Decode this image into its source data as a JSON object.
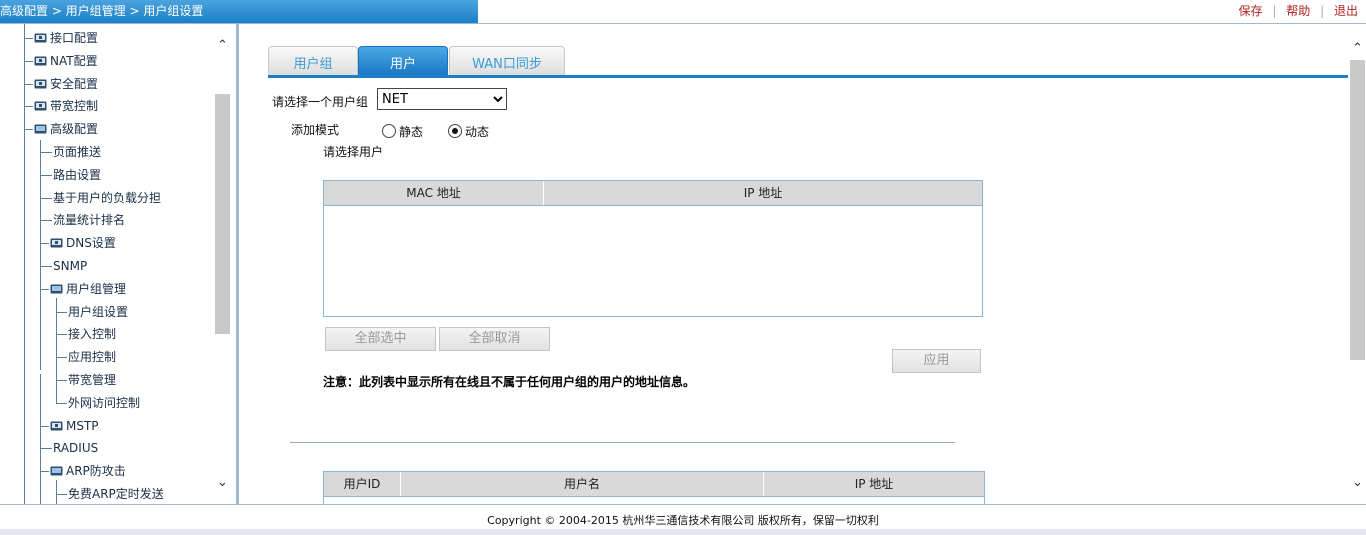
{
  "header": {
    "breadcrumb": "高级配置 > 用户组管理 > 用户组设置",
    "menu": {
      "save": "保存",
      "help": "帮助",
      "logout": "退出",
      "sep": "|"
    }
  },
  "sidebar": {
    "items": [
      {
        "label": "接口配置",
        "icon": "folder-closed-icon"
      },
      {
        "label": "NAT配置",
        "icon": "folder-closed-icon"
      },
      {
        "label": "安全配置",
        "icon": "folder-closed-icon"
      },
      {
        "label": "带宽控制",
        "icon": "folder-closed-icon"
      },
      {
        "label": "高级配置",
        "icon": "folder-open-icon"
      },
      {
        "label": "页面推送"
      },
      {
        "label": "路由设置"
      },
      {
        "label": "基于用户的负载分担"
      },
      {
        "label": "流量统计排名"
      },
      {
        "label": "DNS设置",
        "icon": "folder-closed-icon"
      },
      {
        "label": "SNMP"
      },
      {
        "label": "用户组管理",
        "icon": "folder-open-icon"
      },
      {
        "label": "用户组设置"
      },
      {
        "label": "接入控制"
      },
      {
        "label": "应用控制"
      },
      {
        "label": "带宽管理"
      },
      {
        "label": "外网访问控制"
      },
      {
        "label": "MSTP",
        "icon": "folder-closed-icon"
      },
      {
        "label": "RADIUS"
      },
      {
        "label": "ARP防攻击",
        "icon": "folder-open-icon"
      },
      {
        "label": "免费ARP定时发送"
      }
    ]
  },
  "tabs": [
    {
      "label": "用户组",
      "active": false
    },
    {
      "label": "用户",
      "active": true
    },
    {
      "label": "WAN口同步",
      "active": false
    }
  ],
  "form": {
    "group_label": "请选择一个用户组",
    "group_selected": "NET",
    "mode_label": "添加模式",
    "mode_static": "静态",
    "mode_dynamic": "动态",
    "mode_selected": "动态",
    "select_user_label": "请选择用户"
  },
  "user_table": {
    "columns": [
      "MAC 地址",
      "IP 地址"
    ]
  },
  "buttons": {
    "select_all": "全部选中",
    "deselect_all": "全部取消",
    "apply": "应用"
  },
  "note": "注意：此列表中显示所有在线且不属于任何用户组的用户的地址信息。",
  "group_user_table": {
    "columns": [
      "用户ID",
      "用户名",
      "IP 地址"
    ]
  },
  "footer": {
    "copyright": "Copyright © 2004-2015 杭州华三通信技术有限公司 版权所有，保留一切权利"
  },
  "colors": {
    "accent": "#1b80c8",
    "link": "#b22222"
  }
}
